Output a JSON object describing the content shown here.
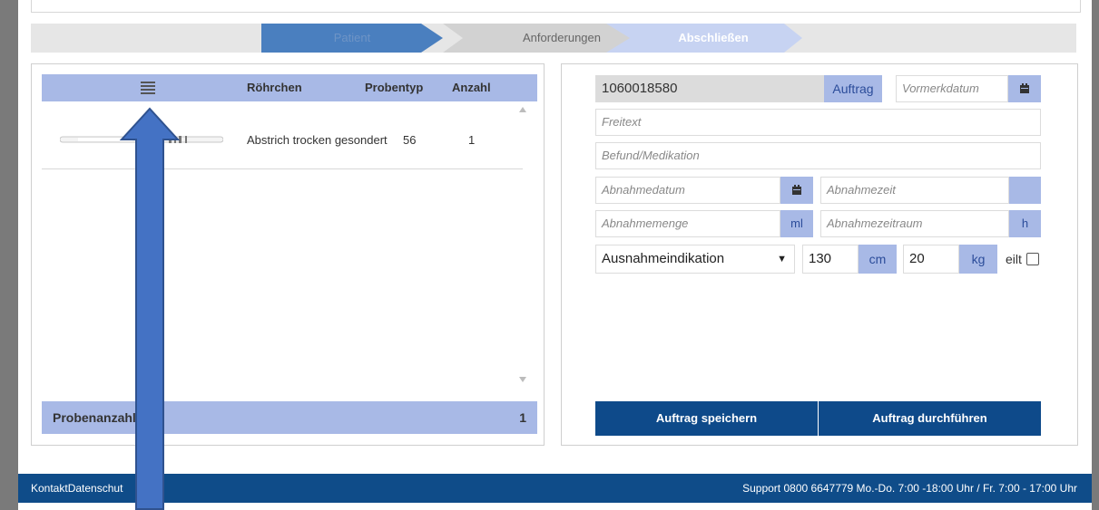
{
  "wizard": {
    "steps": [
      "Patient",
      "Anforderungen",
      "Abschließen"
    ]
  },
  "samples_table": {
    "columns": [
      "Röhrchen",
      "Probentyp",
      "Anzahl"
    ],
    "rows": [
      {
        "probentyp": "Abstrich trocken gesondert",
        "code": "56",
        "anzahl": "1"
      }
    ],
    "footer_label": "Probenanzahl",
    "footer_count": "1"
  },
  "order_form": {
    "order_number": "1060018580",
    "auftrag_label": "Auftrag",
    "vormerkdatum_placeholder": "Vormerkdatum",
    "freitext_placeholder": "Freitext",
    "befund_placeholder": "Befund/Medikation",
    "abnahmedatum_placeholder": "Abnahmedatum",
    "abnahmezeit_placeholder": "Abnahmezeit",
    "abnahmemenge_placeholder": "Abnahmemenge",
    "ml_unit": "ml",
    "abnahmezeitraum_placeholder": "Abnahmezeitraum",
    "h_unit": "h",
    "ausnahme_selected": "Ausnahmeindikation",
    "height_value": "130",
    "height_unit": "cm",
    "weight_value": "20",
    "weight_unit": "kg",
    "eilt_label": "eilt",
    "save_label": "Auftrag speichern",
    "execute_label": "Auftrag durchführen"
  },
  "footer": {
    "links_text": "KontaktDatenschut",
    "support_text": "Support 0800 6647779 Mo.-Do. 7:00 -18:00 Uhr / Fr. 7:00 - 17:00 Uhr"
  },
  "colors": {
    "accent_light": "#a8b9e6",
    "accent_dark": "#0e4a8a",
    "step_active": "#4a7fbf",
    "step_final": "#c7d3f2",
    "arrow_fill": "#4472c4"
  }
}
